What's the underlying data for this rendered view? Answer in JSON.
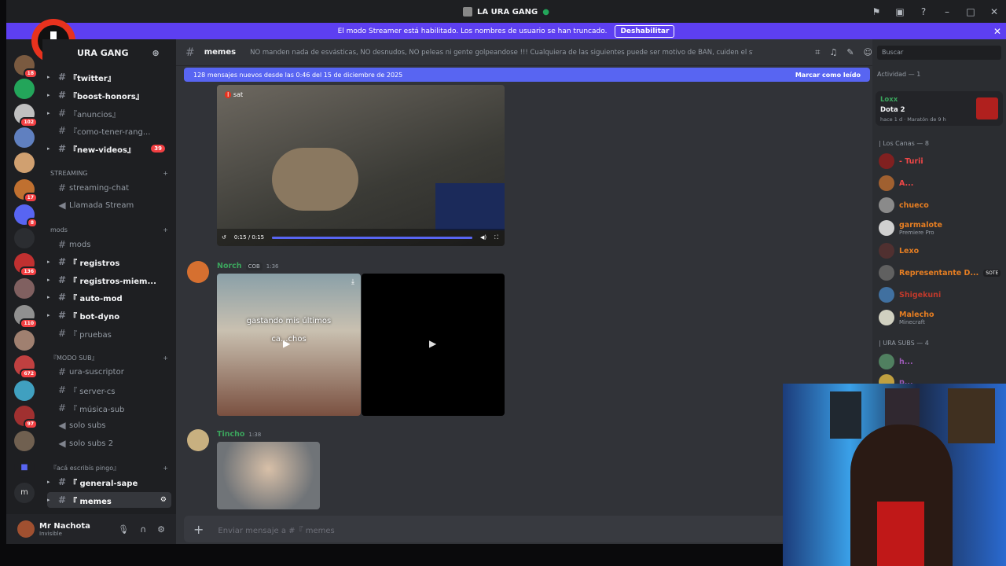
{
  "window": {
    "server_title": "LA URA GANG"
  },
  "banner": {
    "text": "El modo Streamer está habilitado. Los nombres de usuario se han truncado.",
    "button": "Deshabilitar"
  },
  "guild_badges": [
    "18",
    "8",
    "102",
    "17",
    "8",
    "136",
    "110",
    "672",
    "97"
  ],
  "server": {
    "name": "URA GANG"
  },
  "channels_top": [
    {
      "label": "『twitter』",
      "bold": true
    },
    {
      "label": "『boost-honors』",
      "bold": true
    },
    {
      "label": "『anuncios』",
      "bold": false
    },
    {
      "label": "『como-tener-rang...",
      "bold": false
    },
    {
      "label": "『new-videos』",
      "bold": true,
      "count": "39"
    }
  ],
  "cat_streaming": "STREAMING",
  "streaming_channels": [
    {
      "label": "streaming-chat"
    },
    {
      "label": "Llamada Stream"
    }
  ],
  "cat_mods": "mods",
  "mods_channels": [
    {
      "label": "mods",
      "bold": false
    },
    {
      "label": "『 registros",
      "bold": true
    },
    {
      "label": "『 registros-miem...",
      "bold": true
    },
    {
      "label": "『 auto-mod",
      "bold": true
    },
    {
      "label": "『 bot-dyno",
      "bold": true
    },
    {
      "label": "『 pruebas",
      "bold": false
    }
  ],
  "cat_modo_sub": "『MODO SUB』",
  "sub_channels": [
    {
      "label": "ura-suscriptor"
    },
    {
      "label": "『 server-cs"
    },
    {
      "label": "『 música-sub"
    },
    {
      "label": "solo subs"
    },
    {
      "label": "solo subs 2"
    }
  ],
  "cat_acá": "『acá escribís pingo』",
  "bottom_channels": [
    {
      "label": "『 general-sape",
      "bold": true
    },
    {
      "label": "『 memes",
      "bold": true
    }
  ],
  "user": {
    "name": "Mr Nachota",
    "status": "Invisible"
  },
  "channel": {
    "name": "memes",
    "topic": "NO manden nada de esvásticas, NO desnudos, NO peleas ni gente golpeandose !!! Cualquiera de las siguientes puede ser motivo de BAN, cuiden el stream!"
  },
  "newbar": {
    "text": "128 mensajes nuevos desde las 0:46 del 15 de diciembre de 2025",
    "action": "Marcar como leído"
  },
  "video1": {
    "time": "0:15 / 0:15",
    "progress": 1.0,
    "watermark": "sat"
  },
  "msg_norch": {
    "user": "Norch",
    "tag": "COB",
    "time": "1:36",
    "caption": "gastando mis últimos",
    "caption2": "ca...chos"
  },
  "msg_tincho": {
    "user": "Tincho",
    "time": "1:38"
  },
  "composer": {
    "placeholder": "Enviar mensaje a #『 memes"
  },
  "search": {
    "placeholder": "Buscar"
  },
  "activity": {
    "title": "Actividad — 1",
    "user": "Loxx",
    "game": "Dota 2",
    "since": "hace 1 d",
    "detail": "Maratón de 9 h"
  },
  "group1": "| Los Canas — 8",
  "members1": [
    {
      "name": "- Turii",
      "color": "#f04747"
    },
    {
      "name": "A...",
      "color": "#f04747"
    },
    {
      "name": "chueco",
      "color": "#e67e22"
    },
    {
      "name": "garmalote",
      "color": "#e67e22",
      "sub": "Premiere Pro"
    },
    {
      "name": "Lexo",
      "color": "#e67e22"
    },
    {
      "name": "Representante D...",
      "color": "#e67e22",
      "tag": "SOTE"
    },
    {
      "name": "Shigekuni",
      "color": "#c0392b"
    },
    {
      "name": "Malecho",
      "color": "#e67e22",
      "sub": "Minecraft"
    }
  ],
  "group2": "| URA SUBS — 4",
  "members2": [
    {
      "name": "h...",
      "color": "#9b59b6"
    },
    {
      "name": "p...",
      "color": "#9b59b6"
    }
  ],
  "colors": {
    "accent": "#5865f2",
    "banner": "#5d3ff1",
    "online": "#23a55a",
    "mention": "#f23f42"
  }
}
